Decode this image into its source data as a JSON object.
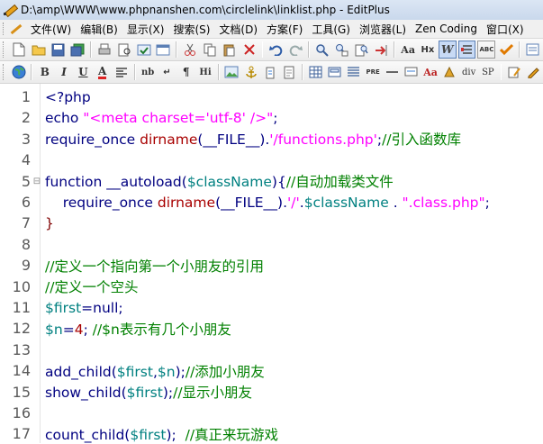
{
  "window": {
    "title": "D:\\amp\\WWW\\www.phpnanshen.com\\circlelink\\linklist.php - EditPlus"
  },
  "menu": {
    "items": [
      "文件(W)",
      "编辑(B)",
      "显示(X)",
      "搜索(S)",
      "文档(D)",
      "方案(F)",
      "工具(G)",
      "浏览器(L)",
      "Zen Coding",
      "窗口(X)"
    ]
  },
  "toolbar2": {
    "bold": "B",
    "italic": "I",
    "underline": "U",
    "fontcolor": "A",
    "nb": "nb",
    "br": "↵",
    "para": "¶",
    "hi": "Hi",
    "font_a": "Aa",
    "hx": "Hx",
    "w": "W",
    "abc": "ABC",
    "div": "div",
    "sp": "SP",
    "pre": "PRE"
  },
  "editor": {
    "lines": [
      {
        "n": "1",
        "fold": "",
        "segs": [
          {
            "c": "c-kw",
            "t": "<?php"
          }
        ]
      },
      {
        "n": "2",
        "fold": "",
        "segs": [
          {
            "c": "c-kw",
            "t": "echo "
          },
          {
            "c": "c-str",
            "t": "\"<meta charset='utf-8' />\""
          },
          {
            "c": "c-kw",
            "t": ";"
          }
        ]
      },
      {
        "n": "3",
        "fold": "",
        "segs": [
          {
            "c": "c-kw",
            "t": "require_once "
          },
          {
            "c": "c-fn",
            "t": "dirname"
          },
          {
            "c": "c-kw",
            "t": "(__FILE__)."
          },
          {
            "c": "c-str",
            "t": "'/functions.php'"
          },
          {
            "c": "c-kw",
            "t": ";"
          },
          {
            "c": "c-cm",
            "t": "//引入函数库"
          }
        ]
      },
      {
        "n": "4",
        "fold": "",
        "segs": []
      },
      {
        "n": "5",
        "fold": "⊟",
        "segs": [
          {
            "c": "c-kw",
            "t": "function "
          },
          {
            "c": "c-kw",
            "t": "__autoload("
          },
          {
            "c": "c-var",
            "t": "$className"
          },
          {
            "c": "c-kw",
            "t": "){"
          },
          {
            "c": "c-cm",
            "t": "//自动加载类文件"
          }
        ]
      },
      {
        "n": "6",
        "fold": "",
        "segs": [
          {
            "c": "c-kw",
            "t": "    require_once "
          },
          {
            "c": "c-fn",
            "t": "dirname"
          },
          {
            "c": "c-kw",
            "t": "(__FILE__)."
          },
          {
            "c": "c-str",
            "t": "'/'"
          },
          {
            "c": "c-kw",
            "t": "."
          },
          {
            "c": "c-var",
            "t": "$className"
          },
          {
            "c": "c-kw",
            "t": " . "
          },
          {
            "c": "c-str",
            "t": "\".class.php\""
          },
          {
            "c": "c-kw",
            "t": ";"
          }
        ]
      },
      {
        "n": "7",
        "fold": "",
        "segs": [
          {
            "c": "c-punc",
            "t": "}"
          }
        ]
      },
      {
        "n": "8",
        "fold": "",
        "segs": []
      },
      {
        "n": "9",
        "fold": "",
        "segs": [
          {
            "c": "c-cm",
            "t": "//定义一个指向第一个小朋友的引用"
          }
        ]
      },
      {
        "n": "10",
        "fold": "",
        "segs": [
          {
            "c": "c-cm",
            "t": "//定义一个空头"
          }
        ]
      },
      {
        "n": "11",
        "fold": "",
        "segs": [
          {
            "c": "c-var",
            "t": "$first"
          },
          {
            "c": "c-kw",
            "t": "=null;"
          }
        ]
      },
      {
        "n": "12",
        "fold": "",
        "segs": [
          {
            "c": "c-var",
            "t": "$n"
          },
          {
            "c": "c-kw",
            "t": "="
          },
          {
            "c": "c-fn",
            "t": "4"
          },
          {
            "c": "c-kw",
            "t": "; "
          },
          {
            "c": "c-cm",
            "t": "//$n表示有几个小朋友"
          }
        ]
      },
      {
        "n": "13",
        "fold": "",
        "segs": []
      },
      {
        "n": "14",
        "fold": "",
        "segs": [
          {
            "c": "c-kw",
            "t": "add_child("
          },
          {
            "c": "c-var",
            "t": "$first"
          },
          {
            "c": "c-kw",
            "t": ","
          },
          {
            "c": "c-var",
            "t": "$n"
          },
          {
            "c": "c-kw",
            "t": ");"
          },
          {
            "c": "c-cm",
            "t": "//添加小朋友"
          }
        ]
      },
      {
        "n": "15",
        "fold": "",
        "segs": [
          {
            "c": "c-kw",
            "t": "show_child("
          },
          {
            "c": "c-var",
            "t": "$first"
          },
          {
            "c": "c-kw",
            "t": ");"
          },
          {
            "c": "c-cm",
            "t": "//显示小朋友"
          }
        ]
      },
      {
        "n": "16",
        "fold": "",
        "segs": []
      },
      {
        "n": "17",
        "fold": "",
        "segs": [
          {
            "c": "c-kw",
            "t": "count_child("
          },
          {
            "c": "c-var",
            "t": "$first"
          },
          {
            "c": "c-kw",
            "t": ");  "
          },
          {
            "c": "c-cm",
            "t": "//真正来玩游戏"
          }
        ]
      }
    ]
  }
}
